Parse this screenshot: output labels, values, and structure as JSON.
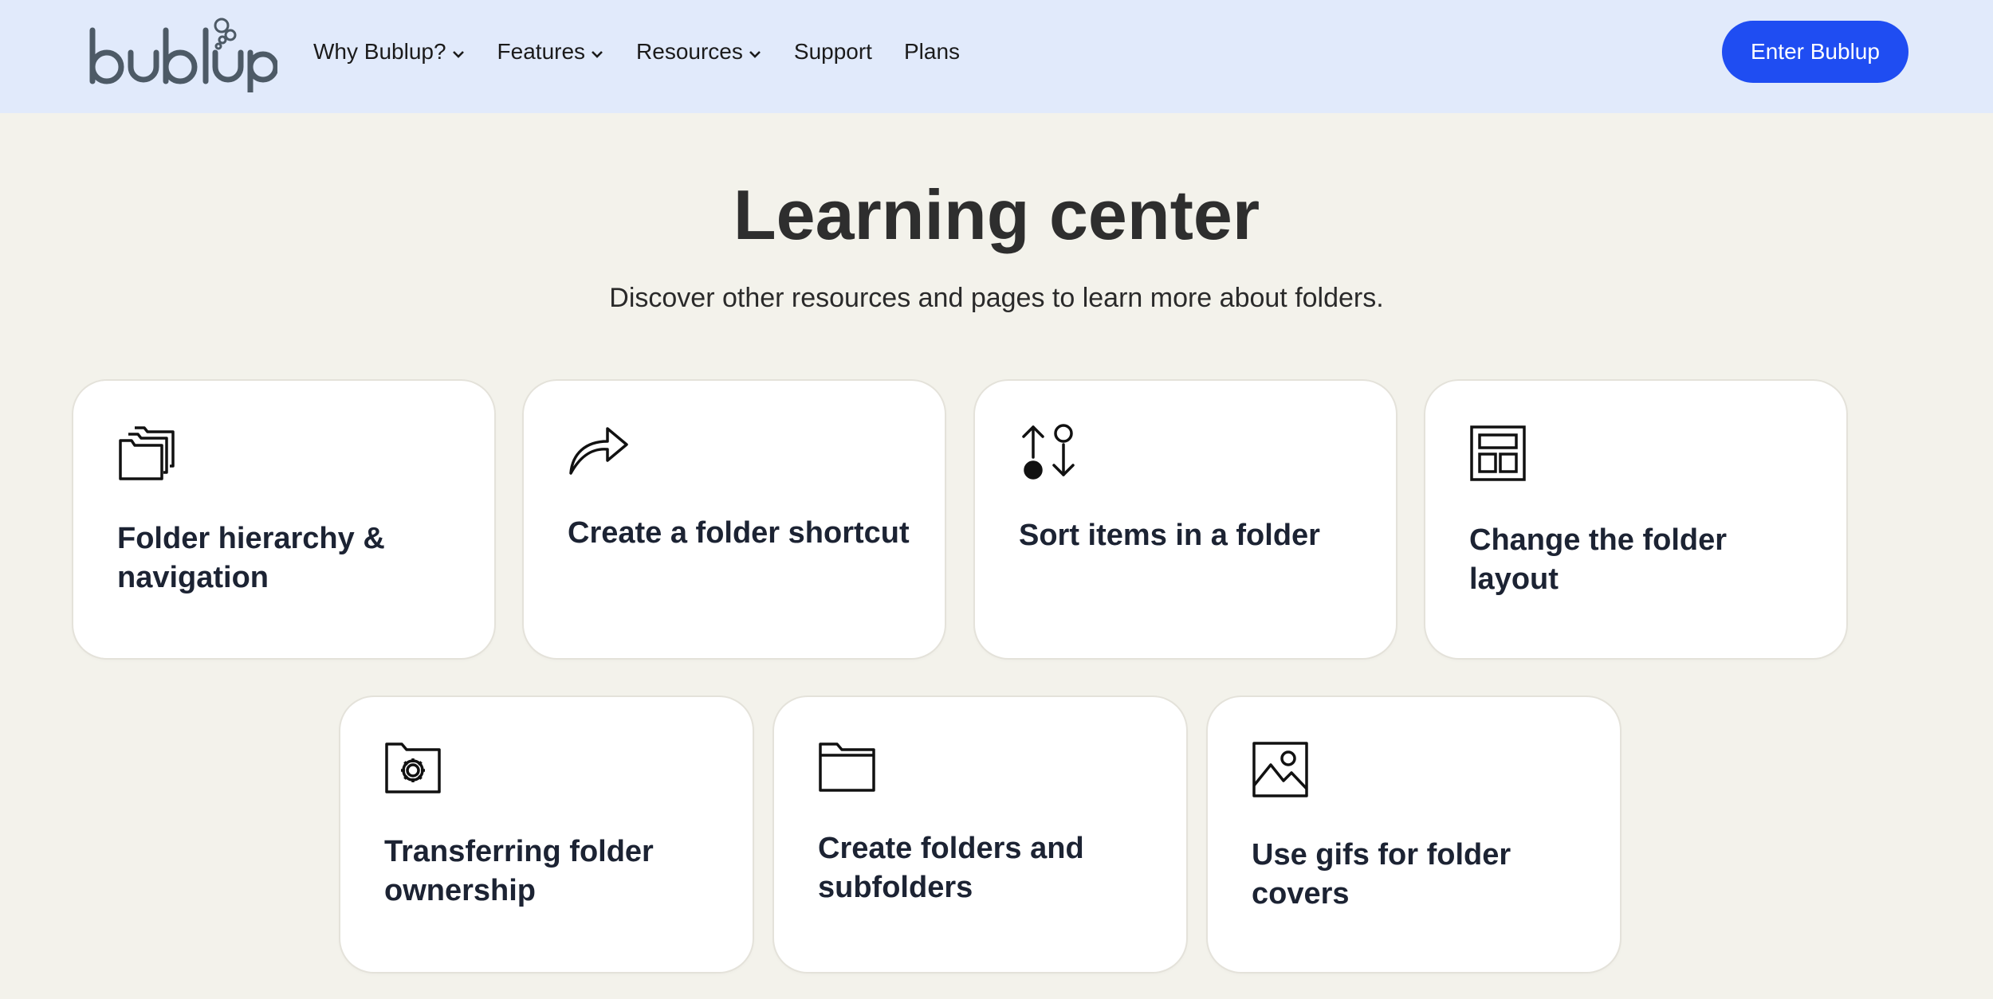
{
  "nav": {
    "logo_text": "bublup",
    "items": [
      {
        "label": "Why Bublup?",
        "dropdown": true
      },
      {
        "label": "Features",
        "dropdown": true
      },
      {
        "label": "Resources",
        "dropdown": true
      },
      {
        "label": "Support",
        "dropdown": false
      },
      {
        "label": "Plans",
        "dropdown": false
      }
    ],
    "cta_label": "Enter Bublup"
  },
  "hero": {
    "title": "Learning center",
    "subtitle": "Discover other resources and pages to learn more about folders."
  },
  "cards": [
    {
      "title": "Folder hierarchy & navigation",
      "icon": "stacked-folders-icon"
    },
    {
      "title": "Create a folder shortcut",
      "icon": "share-arrow-icon"
    },
    {
      "title": "Sort items in a folder",
      "icon": "sort-icon"
    },
    {
      "title": "Change the folder layout",
      "icon": "layout-icon"
    },
    {
      "title": "Transferring folder ownership",
      "icon": "folder-gear-icon"
    },
    {
      "title": "Create folders and subfolders",
      "icon": "folder-icon"
    },
    {
      "title": "Use gifs for folder covers",
      "icon": "image-icon"
    }
  ],
  "colors": {
    "nav_bg": "#e1eafb",
    "page_bg": "#f3f2eb",
    "accent": "#1f4df2"
  }
}
